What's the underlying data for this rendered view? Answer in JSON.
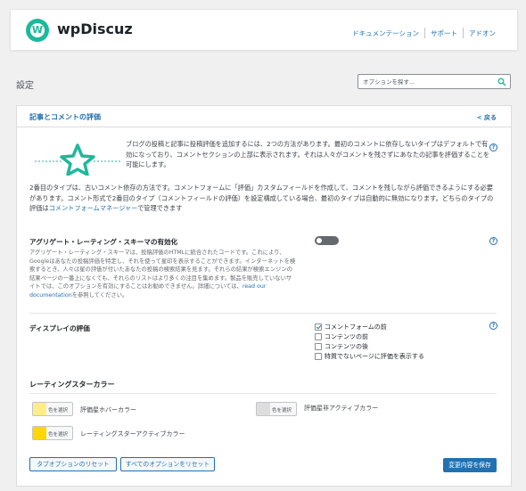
{
  "header": {
    "brand": "wpDiscuz",
    "logo_letter": "W",
    "nav": [
      "ドキュメンテーション",
      "サポート",
      "アドオン"
    ]
  },
  "page": {
    "title": "設定",
    "search_placeholder": "オプションを探す..."
  },
  "panel": {
    "title": "記事とコメントの評価",
    "back_label": "< 戻る",
    "intro": "ブログの投稿と記事に投稿評価を追加するには、2つの方法があります。最初のコメントに依存しないタイプはデフォルトで有効になっており、コメントセクションの上部に表示されます。それは人々がコメントを残さずにあなたの記事を評価することを可能にします。",
    "para2_before": "2番目のタイプは、古いコメント依存の方法です。コメントフォームに「評価」カスタムフィールドを作成して、コメントを残しながら評価できるようにする必要があります。コメント形式で2番目のタイプ（コメントフィールドの評価）を設定構成している場合、最初のタイプは自動的に無効になります。どちらのタイプの評価は",
    "para2_link": "コメントフォームマネージャー",
    "para2_after": "で管理できます"
  },
  "aggregate": {
    "label": "アグリゲート・レーティング・スキーマの有効化",
    "desc_before": "アグリゲート・レーティング・スキーマは、投稿評価のHTMLに統合されたコードです。これにより、Googleはあなたの投稿評価を特定し、それを使って星印を表示することができます。インターネットを検索するとき、人々は星の評価が付いたあなたの投稿の検索結果を見ます。それらの結果が検索エンジンの結果ページの一番上になくても、それらのリストはより多くの注目を集めます。製品を販売していないサイトでは、このオプションを有効にすることはお勧めできません。詳細については、",
    "desc_link": "read our documentation",
    "desc_after": "を参照してください。",
    "enabled": false
  },
  "display": {
    "label": "ディスプレイの評価",
    "options": [
      {
        "label": "コメントフォームの前",
        "checked": true
      },
      {
        "label": "コンテンツの前",
        "checked": false
      },
      {
        "label": "コンテンツの後",
        "checked": false
      },
      {
        "label": "特質でないページに評価を表示する",
        "checked": false
      }
    ]
  },
  "colors": {
    "heading": "レーティングスターカラー",
    "select_label": "色を選択",
    "items": [
      {
        "label": "評価星ホバーカラー",
        "color": "#FFED85"
      },
      {
        "label": "評価星非アクティブカラー",
        "color": "#DDDDDD"
      },
      {
        "label": "レーティングスターアクティブカラー",
        "color": "#FFD700"
      }
    ]
  },
  "footer": {
    "reset_tab": "タブオプションのリセット",
    "reset_all": "すべてのオプションをリセット",
    "save": "変更内容を保存"
  },
  "help_glyph": "?",
  "accent": "#2271b1",
  "brand_color": "#1db99a"
}
